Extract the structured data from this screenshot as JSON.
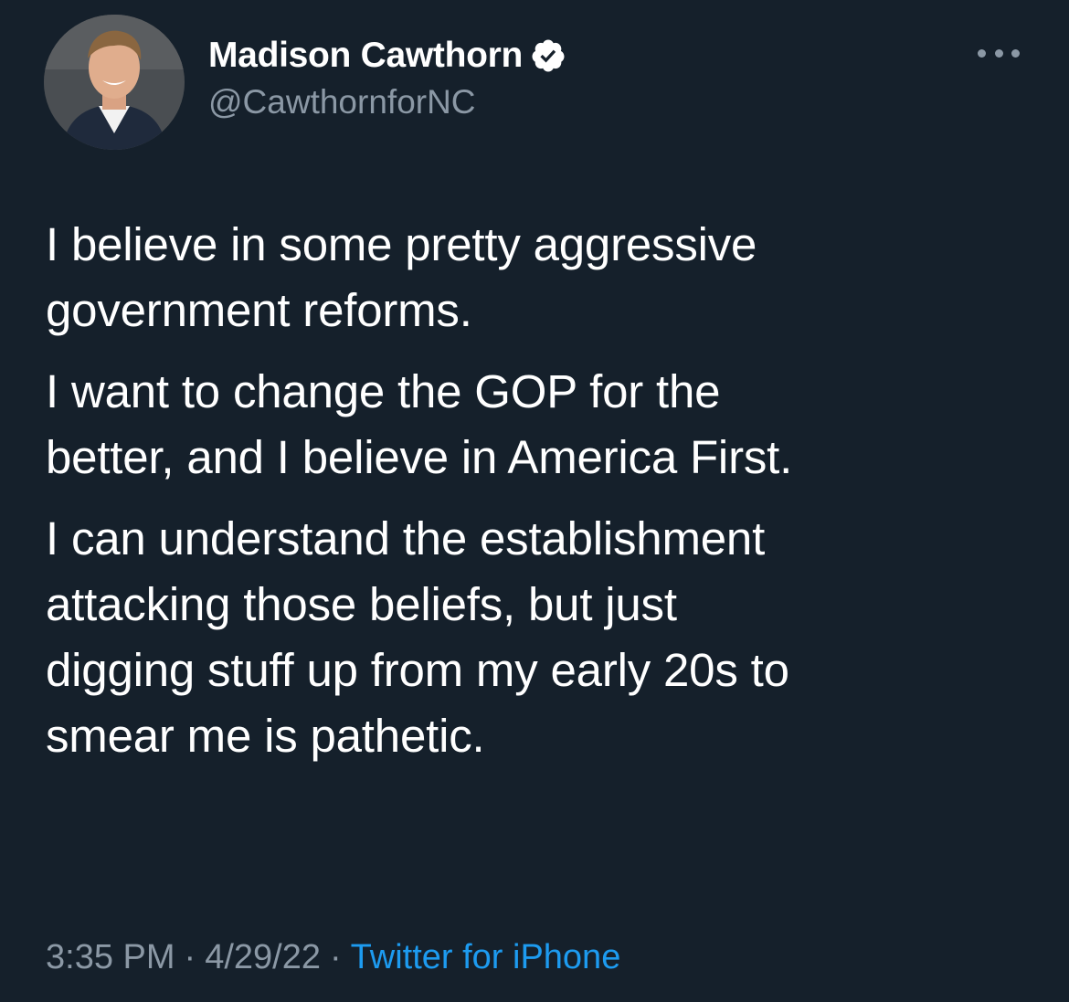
{
  "tweet": {
    "author": {
      "display_name": "Madison Cawthorn",
      "handle": "@CawthornforNC",
      "verified_icon": "verified-badge-icon",
      "avatar_icon": "profile-photo"
    },
    "more_icon": "more-options-icon",
    "paragraphs": [
      "I believe in some pretty aggressive\ngovernment reforms.",
      "I want to change the GOP for the\nbetter, and I believe in America First.",
      "I can understand the establishment\nattacking those beliefs, but just\ndigging stuff up from my early 20s to\nsmear me is pathetic."
    ],
    "time": "3:35 PM",
    "separator": "·",
    "date": "4/29/22",
    "source": "Twitter for iPhone"
  },
  "colors": {
    "background": "#15202b",
    "text": "#ffffff",
    "secondary_text": "#8b98a5",
    "link": "#1d9bf0"
  }
}
